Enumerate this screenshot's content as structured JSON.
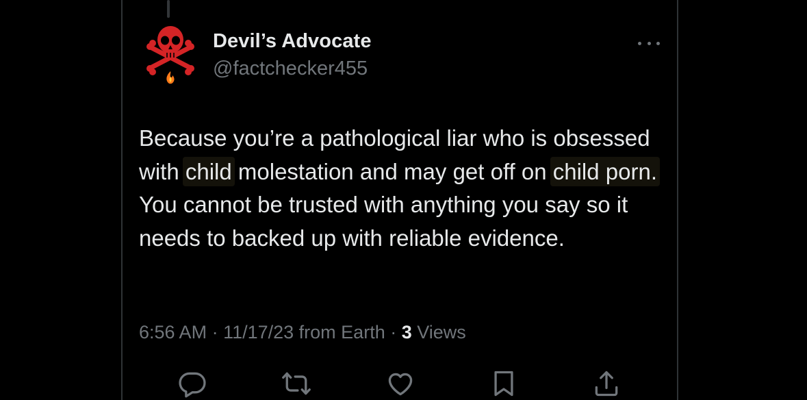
{
  "tweet": {
    "author": {
      "display_name": "Devil’s Advocate",
      "handle": "@factchecker455",
      "avatar_icon": "skull-crossbones-fire-icon"
    },
    "more_icon": "more-horizontal-icon",
    "body": {
      "segments": [
        {
          "text": "Because you’re a pathological liar who is obsessed with ",
          "highlight": false
        },
        {
          "text": "child",
          "highlight": true
        },
        {
          "text": " molestation and may get off on ",
          "highlight": false
        },
        {
          "text": "child porn.",
          "highlight": true
        },
        {
          "text": " You cannot be trusted with anything you say so it needs to backed up with reliable evidence.",
          "highlight": false
        }
      ]
    },
    "meta": {
      "time": "6:56 AM",
      "separator1": " · ",
      "date": "11/17/23",
      "source": " from Earth",
      "separator2": " · ",
      "views_count": "3",
      "views_label": " Views"
    },
    "actions": [
      {
        "name": "reply",
        "icon": "reply-icon"
      },
      {
        "name": "repost",
        "icon": "repost-icon"
      },
      {
        "name": "like",
        "icon": "heart-icon"
      },
      {
        "name": "bookmark",
        "icon": "bookmark-icon"
      },
      {
        "name": "share",
        "icon": "share-icon"
      }
    ]
  },
  "colors": {
    "background": "#000000",
    "text_primary": "#e7e9ea",
    "text_secondary": "#71767b",
    "avatar_red": "#d42426"
  }
}
